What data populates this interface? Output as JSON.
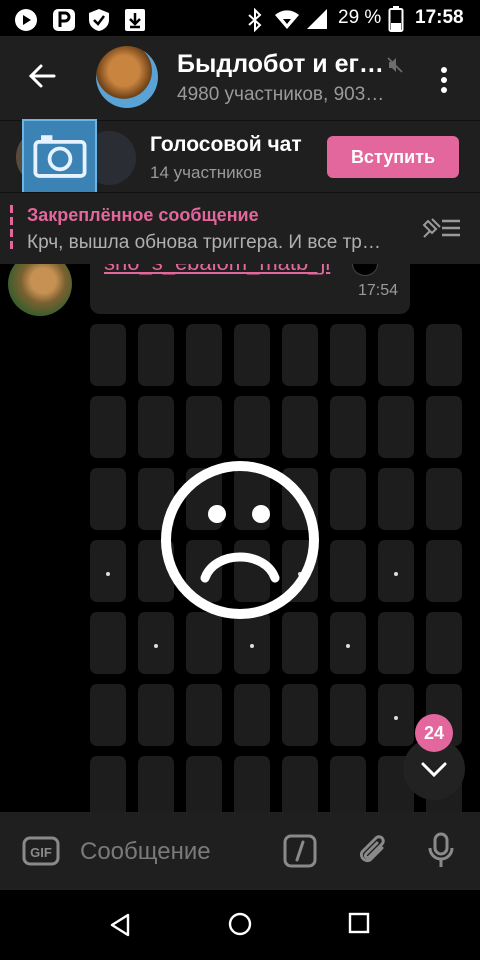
{
  "status_bar": {
    "battery_percent": "29 %",
    "time": "17:58"
  },
  "header": {
    "title": "Быдлобот и ег…",
    "subtitle": "4980 участников, 903…"
  },
  "voice_chat": {
    "title": "Голосовой чат",
    "participants": "14 участников",
    "join_label": "Вступить"
  },
  "pinned": {
    "title": "Закреплённое сообщение",
    "text": "Крч, вышла обнова триггера. И все тр…"
  },
  "message": {
    "text": "sho_s_ebalom_matb_ji",
    "time": "17:54"
  },
  "scroll": {
    "unread_count": "24"
  },
  "input": {
    "placeholder": "Сообщение"
  },
  "colors": {
    "accent": "#e3679c",
    "panel": "#1f1f1f",
    "background": "#000000"
  }
}
